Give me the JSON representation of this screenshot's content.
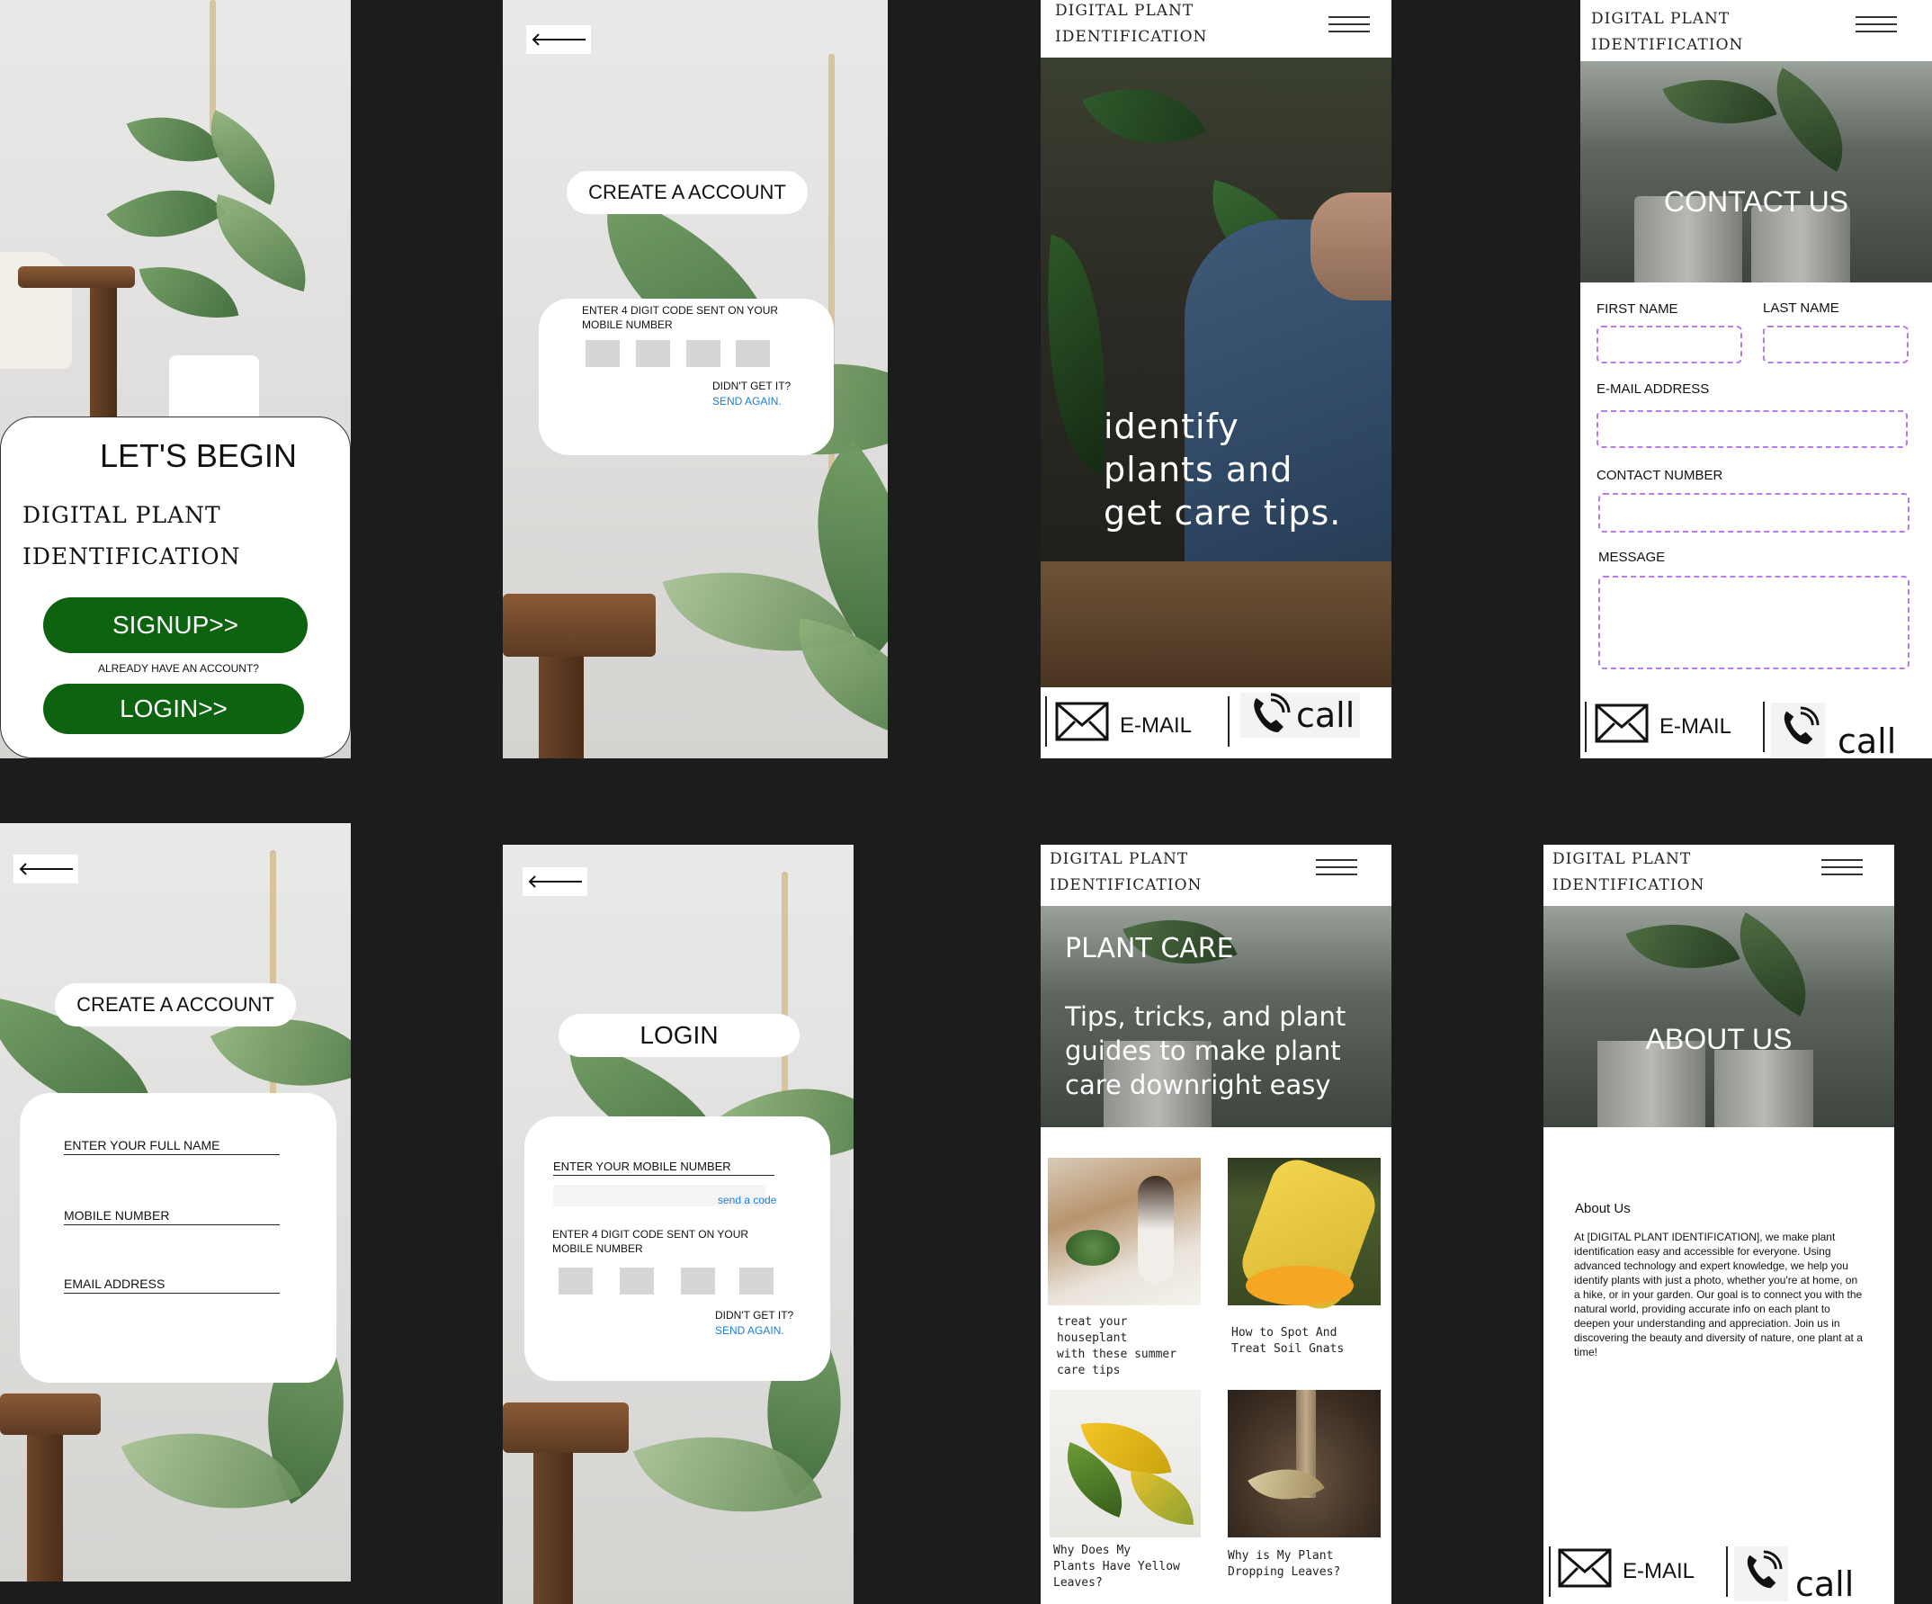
{
  "s1": {
    "title": "LET'S BEGIN",
    "brand_line1": "DIGITAL PLANT",
    "brand_line2": "IDENTIFICATION",
    "signup": "SIGNUP>>",
    "already": "ALREADY HAVE AN ACCOUNT?",
    "login": "LOGIN>>"
  },
  "s2": {
    "title": "CREATE A ACCOUNT",
    "code_prompt_l1": "ENTER 4 DIGIT CODE SENT ON YOUR",
    "code_prompt_l2": "MOBILE NUMBER",
    "didnt_get": "DIDN'T GET IT?",
    "send_again": "SEND AGAIN."
  },
  "s3": {
    "brand_line1": "DIGITAL PLANT",
    "brand_line2": "IDENTIFICATION",
    "hero_l1": "identify",
    "hero_l2": "plants and",
    "hero_l3": "get care tips.",
    "email": "E-MAIL",
    "call": "call"
  },
  "s4": {
    "brand_line1": "DIGITAL PLANT",
    "brand_line2": "IDENTIFICATION",
    "hero": "CONTACT US",
    "first_name": "FIRST NAME",
    "last_name": "LAST NAME",
    "email_address": "E-MAIL ADDRESS",
    "contact_number": "CONTACT NUMBER",
    "message": "MESSAGE",
    "email": "E-MAIL",
    "call": "call"
  },
  "s5": {
    "title": "CREATE A ACCOUNT",
    "full_name": "ENTER YOUR FULL NAME",
    "mobile": "MOBILE NUMBER",
    "email": "EMAIL ADDRESS"
  },
  "s6": {
    "title": "LOGIN",
    "mobile": "ENTER YOUR MOBILE NUMBER",
    "send_code": "send a code",
    "code_prompt_l1": "ENTER 4 DIGIT CODE SENT ON YOUR",
    "code_prompt_l2": "MOBILE NUMBER",
    "didnt_get": "DIDN'T GET IT?",
    "send_again": "SEND AGAIN."
  },
  "s7": {
    "brand_line1": "DIGITAL PLANT",
    "brand_line2": "IDENTIFICATION",
    "hero_title": "PLANT CARE",
    "hero_sub_l1": "Tips, tricks, and plant",
    "hero_sub_l2": "guides to make plant",
    "hero_sub_l3": "care downright easy",
    "articles": [
      {
        "l1": "treat your",
        "l2": "houseplant",
        "l3": "with these summer",
        "l4": "care tips"
      },
      {
        "l1": "How to Spot And",
        "l2": "Treat Soil Gnats",
        "l3": "",
        "l4": ""
      },
      {
        "l1": "Why Does My",
        "l2": "Plants Have Yellow",
        "l3": "Leaves?",
        "l4": ""
      },
      {
        "l1": "Why is My Plant",
        "l2": "Dropping Leaves?",
        "l3": "",
        "l4": ""
      }
    ]
  },
  "s8": {
    "brand_line1": "DIGITAL PLANT",
    "brand_line2": "IDENTIFICATION",
    "hero": "ABOUT US",
    "about_heading": "About Us",
    "about_body": "At [DIGITAL PLANT IDENTIFICATION], we make plant identification easy and accessible for everyone. Using advanced technology and expert knowledge, we help you identify plants with just a photo, whether you're at home, on a hike, or in your garden. Our goal is to connect you with the natural world, providing accurate info on each plant to deepen your understanding and appreciation. Join us in discovering the beauty and diversity of nature, one plant at a time!",
    "email": "E-MAIL",
    "call": "call"
  },
  "colors": {
    "button_green": "#0e6311",
    "link_blue": "#1a7dd6",
    "dashed_purple": "#b77be8",
    "canvas": "#1c1c1c"
  }
}
